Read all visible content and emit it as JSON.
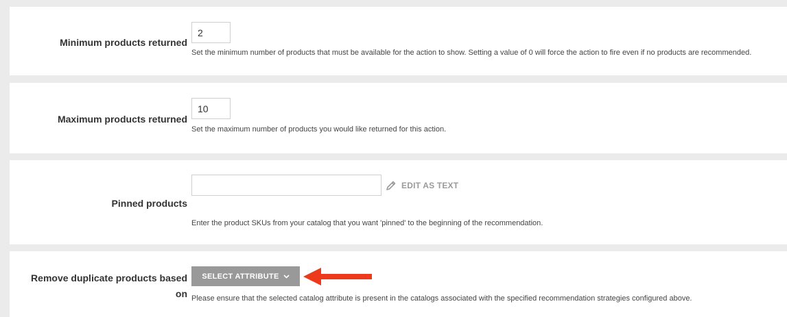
{
  "fields": {
    "min_products": {
      "label": "Minimum products returned",
      "value": "2",
      "help": "Set the minimum number of products that must be available for the action to show. Setting a value of 0 will force the action to fire even if no products are recommended."
    },
    "max_products": {
      "label": "Maximum products returned",
      "value": "10",
      "help": "Set the maximum number of products you would like returned for this action."
    },
    "pinned_products": {
      "label": "Pinned products",
      "value": "",
      "edit_link": "EDIT AS TEXT",
      "help": "Enter the product SKUs from your catalog that you want 'pinned' to the beginning of the recommendation."
    },
    "remove_duplicates": {
      "label": "Remove duplicate products based on",
      "button_label": "SELECT ATTRIBUTE",
      "help": "Please ensure that the selected catalog attribute is present in the catalogs associated with the specified recommendation strategies configured above."
    }
  },
  "icons": {
    "edit": "pencil-icon",
    "dropdown": "chevron-down-icon",
    "annotation": "red-arrow-icon"
  },
  "colors": {
    "background": "#ebebeb",
    "panel": "#ffffff",
    "button": "#999999",
    "link": "#9a9a9a",
    "arrow": "#ee3a1c"
  }
}
